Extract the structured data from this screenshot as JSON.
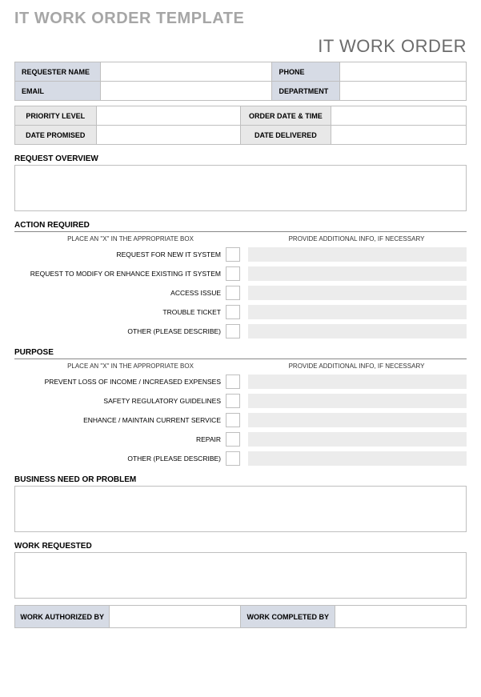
{
  "titles": {
    "main": "IT WORK ORDER TEMPLATE",
    "sub": "IT WORK ORDER"
  },
  "info1": {
    "requester_name": "REQUESTER NAME",
    "phone": "PHONE",
    "email": "EMAIL",
    "department": "DEPARTMENT"
  },
  "info2": {
    "priority_level": "PRIORITY LEVEL",
    "order_date_time": "ORDER DATE & TIME",
    "date_promised": "DATE PROMISED",
    "date_delivered": "DATE DELIVERED"
  },
  "sections": {
    "request_overview": "REQUEST OVERVIEW",
    "action_required": "ACTION REQUIRED",
    "purpose": "PURPOSE",
    "business_need": "BUSINESS NEED OR PROBLEM",
    "work_requested": "WORK REQUESTED"
  },
  "hints": {
    "left": "PLACE AN \"X\" IN THE APPROPRIATE BOX",
    "right": "PROVIDE ADDITIONAL INFO, IF NECESSARY"
  },
  "action_items": [
    "REQUEST FOR NEW IT SYSTEM",
    "REQUEST TO MODIFY OR ENHANCE EXISTING IT SYSTEM",
    "ACCESS ISSUE",
    "TROUBLE TICKET",
    "OTHER (PLEASE DESCRIBE)"
  ],
  "purpose_items": [
    "PREVENT LOSS OF INCOME / INCREASED EXPENSES",
    "SAFETY REGULATORY GUIDELINES",
    "ENHANCE / MAINTAIN CURRENT SERVICE",
    "REPAIR",
    "OTHER (PLEASE DESCRIBE)"
  ],
  "footer": {
    "authorized": "WORK AUTHORIZED BY",
    "completed": "WORK COMPLETED BY"
  }
}
